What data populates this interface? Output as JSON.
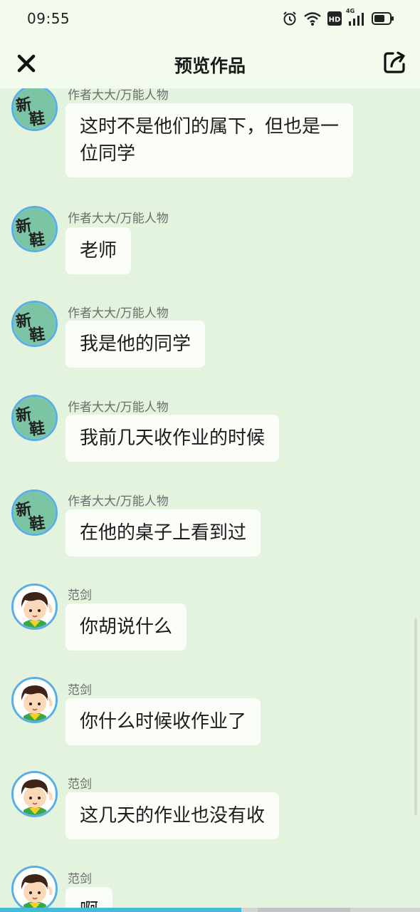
{
  "status_bar": {
    "time": "09:55",
    "network_label": "4G"
  },
  "header": {
    "title": "预览作品"
  },
  "messages": [
    {
      "sender": "作者大大/万能人物",
      "text": "这时不是他们的属下，但也是一位同学",
      "avatar": "xin-sticker"
    },
    {
      "sender": "作者大大/万能人物",
      "text": "老师",
      "avatar": "xin-sticker"
    },
    {
      "sender": "作者大大/万能人物",
      "text": "我是他的同学",
      "avatar": "xin-sticker"
    },
    {
      "sender": "作者大大/万能人物",
      "text": "我前几天收作业的时候",
      "avatar": "xin-sticker"
    },
    {
      "sender": "作者大大/万能人物",
      "text": "在他的桌子上看到过",
      "avatar": "xin-sticker"
    },
    {
      "sender": "范剑",
      "text": "你胡说什么",
      "avatar": "cartoon-boy"
    },
    {
      "sender": "范剑",
      "text": "你什么时候收作业了",
      "avatar": "cartoon-boy"
    },
    {
      "sender": "范剑",
      "text": "这几天的作业也没有收",
      "avatar": "cartoon-boy"
    },
    {
      "sender": "范剑",
      "text": "啊",
      "avatar": "cartoon-boy"
    }
  ],
  "playback": {
    "progress": 0.575
  },
  "colors": {
    "background": "#e3f3de",
    "bubble": "#fbfdf9",
    "avatar_ring": "#5aaee6",
    "progress": "#44bcd8"
  }
}
